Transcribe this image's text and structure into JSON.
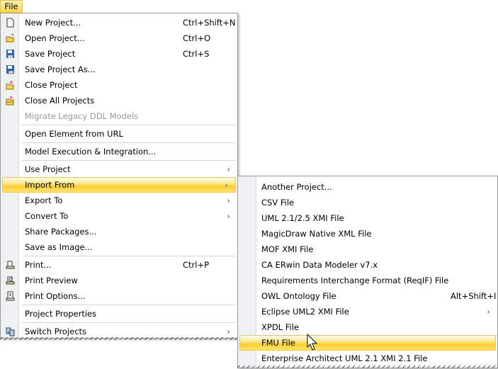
{
  "menubar": {
    "file": "File"
  },
  "file_menu": [
    {
      "label": "New Project...",
      "shortcut": "Ctrl+Shift+N",
      "icon": "new-document-icon"
    },
    {
      "label": "Open Project...",
      "shortcut": "Ctrl+O",
      "icon": "open-folder-icon"
    },
    {
      "label": "Save Project",
      "shortcut": "Ctrl+S",
      "icon": "save-icon"
    },
    {
      "label": "Save Project As...",
      "icon": "save-as-icon"
    },
    {
      "label": "Close Project",
      "icon": "close-project-icon"
    },
    {
      "label": "Close All Projects",
      "icon": "close-all-projects-icon"
    },
    {
      "label": "Migrate Legacy DDL Models",
      "disabled": true
    },
    {
      "label": "Open Element from URL"
    },
    {
      "label": "Model Execution & Integration..."
    },
    {
      "label": "Use Project",
      "submenu": true
    },
    {
      "label": "Import From",
      "submenu": true,
      "highlighted": true
    },
    {
      "label": "Export To",
      "submenu": true
    },
    {
      "label": "Convert To",
      "submenu": true
    },
    {
      "label": "Share Packages..."
    },
    {
      "label": "Save as Image..."
    },
    {
      "label": "Print...",
      "shortcut": "Ctrl+P",
      "icon": "print-icon"
    },
    {
      "label": "Print Preview",
      "icon": "print-preview-icon"
    },
    {
      "label": "Print Options...",
      "icon": "print-options-icon"
    },
    {
      "label": "Project Properties"
    },
    {
      "label": "Switch Projects",
      "submenu": true,
      "icon": "switch-projects-icon"
    }
  ],
  "import_submenu": [
    {
      "label": "Another Project..."
    },
    {
      "label": "CSV File"
    },
    {
      "label": "UML 2.1/2.5 XMI File"
    },
    {
      "label": "MagicDraw Native XML File"
    },
    {
      "label": "MOF XMI File"
    },
    {
      "label": "CA ERwin Data Modeler v7.x"
    },
    {
      "label": "Requirements Interchange Format (ReqIF) File"
    },
    {
      "label": "OWL Ontology File",
      "shortcut": "Alt+Shift+I"
    },
    {
      "label": "Eclipse UML2 XMI File",
      "submenu": true
    },
    {
      "label": "XPDL File"
    },
    {
      "label": "FMU File",
      "highlighted": true
    },
    {
      "label": "Enterprise Architect UML 2.1 XMI 2.1 File"
    }
  ],
  "arrow": "›"
}
